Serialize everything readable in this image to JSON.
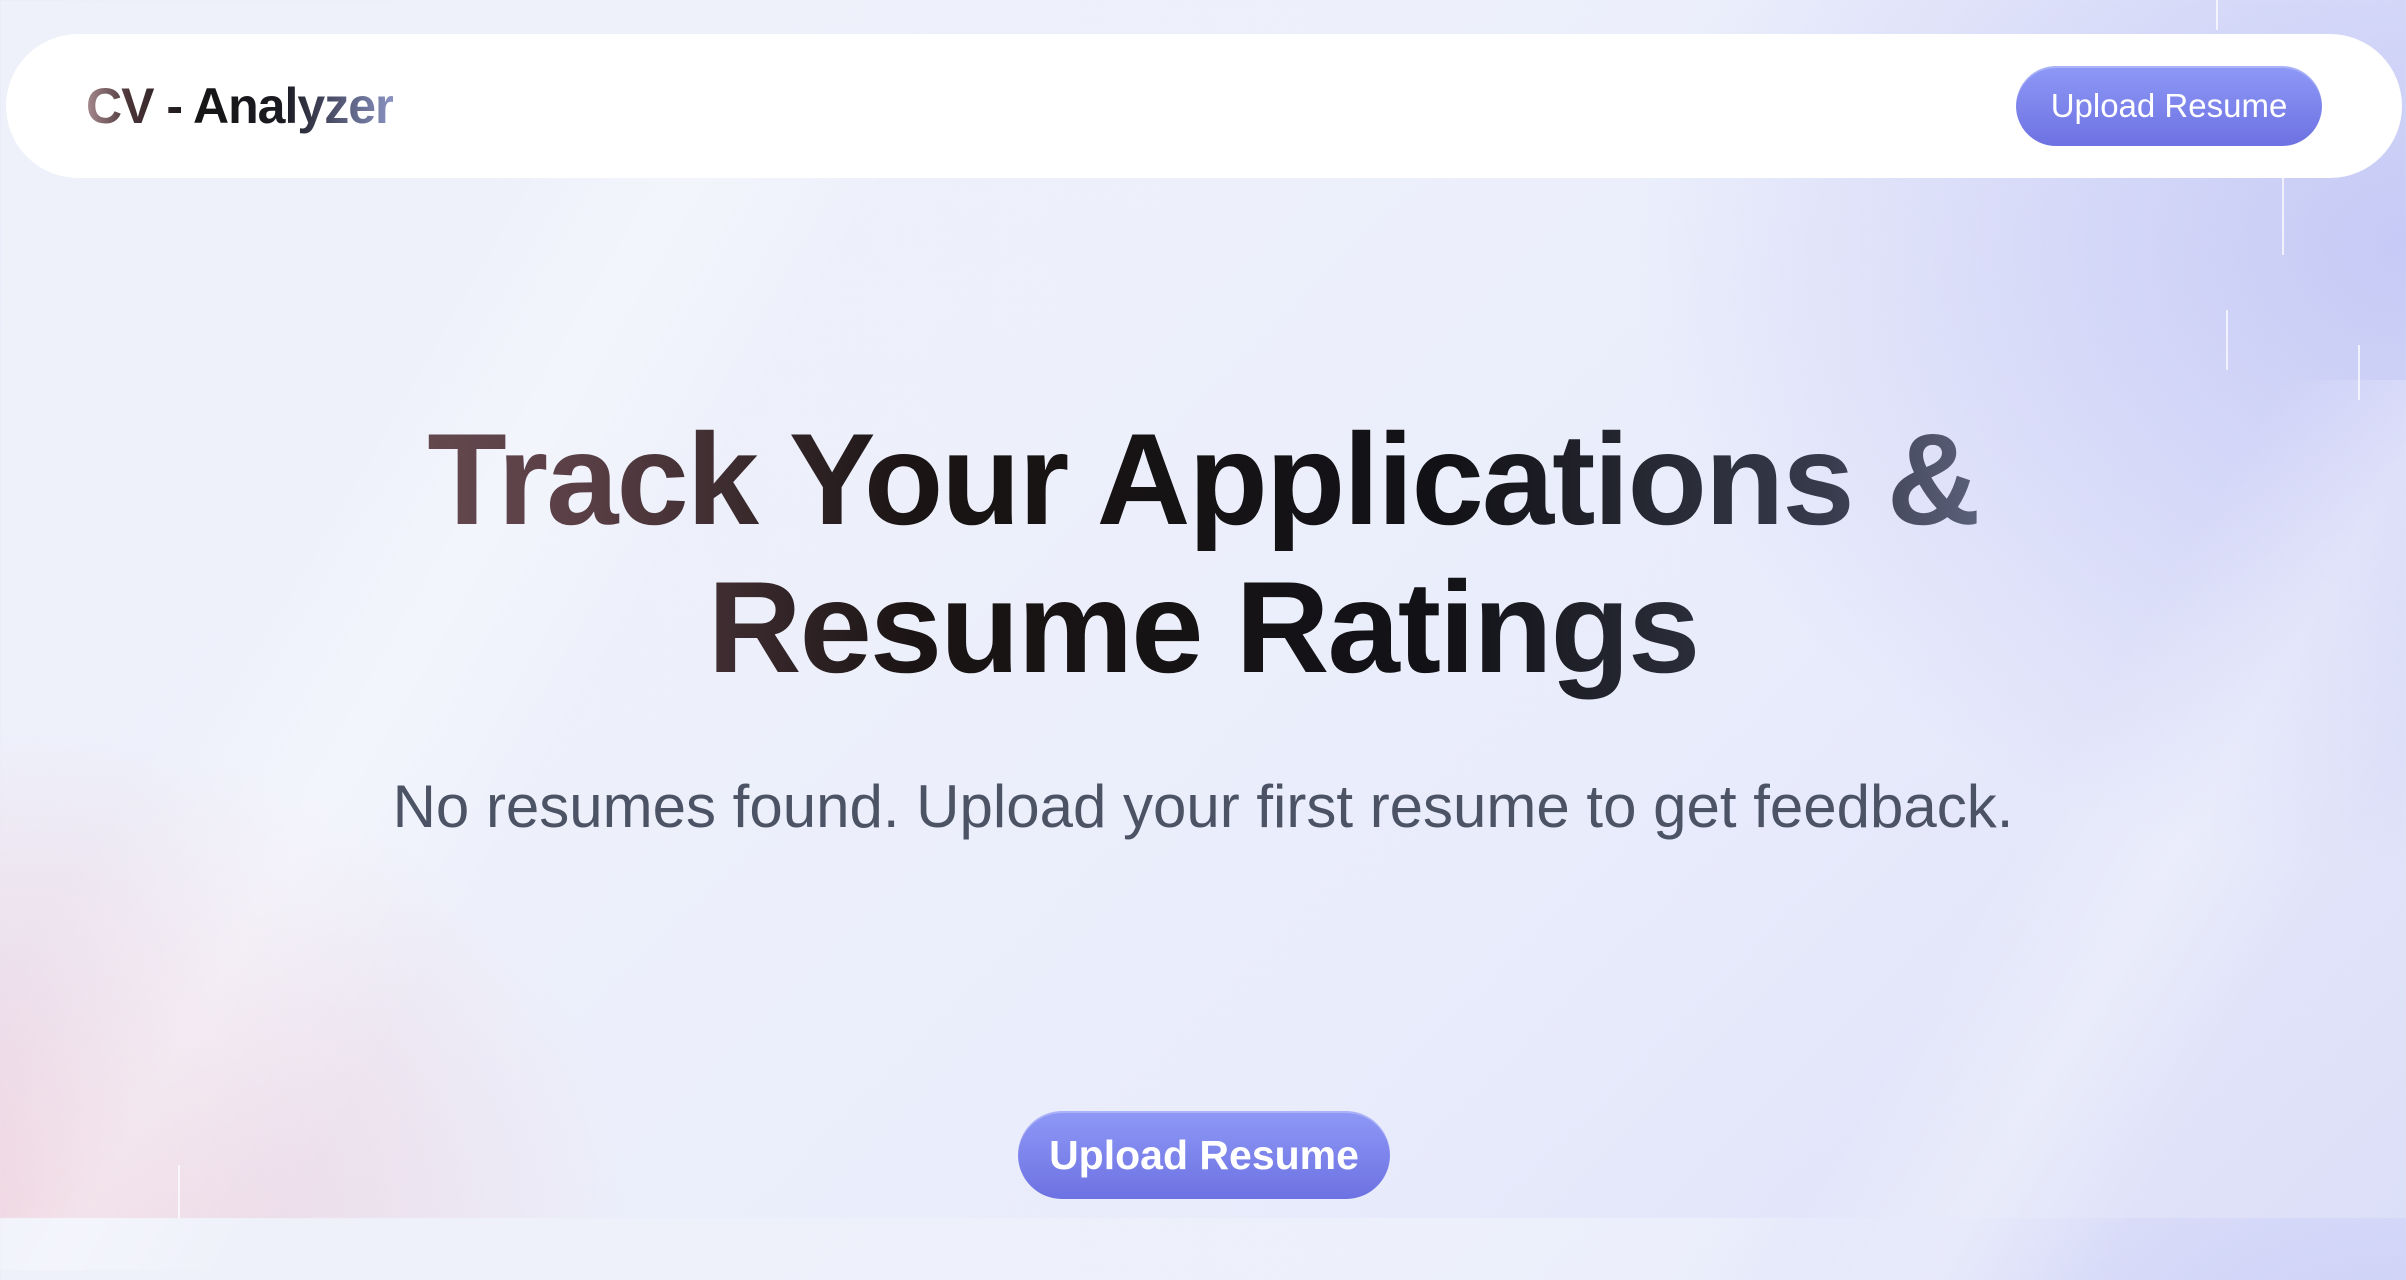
{
  "navbar": {
    "brand": "CV - Analyzer",
    "upload_label": "Upload Resume"
  },
  "hero": {
    "title_line1": "Track Your Applications &",
    "title_line2": "Resume Ratings",
    "subtitle": "No resumes found. Upload your first resume to get feedback.",
    "upload_label": "Upload Resume"
  },
  "colors": {
    "button_gradient_top": "#8e99f6",
    "button_gradient_bottom": "#6d71e2",
    "subtitle_text": "#4b5365",
    "navbar_bg": "#ffffff"
  }
}
